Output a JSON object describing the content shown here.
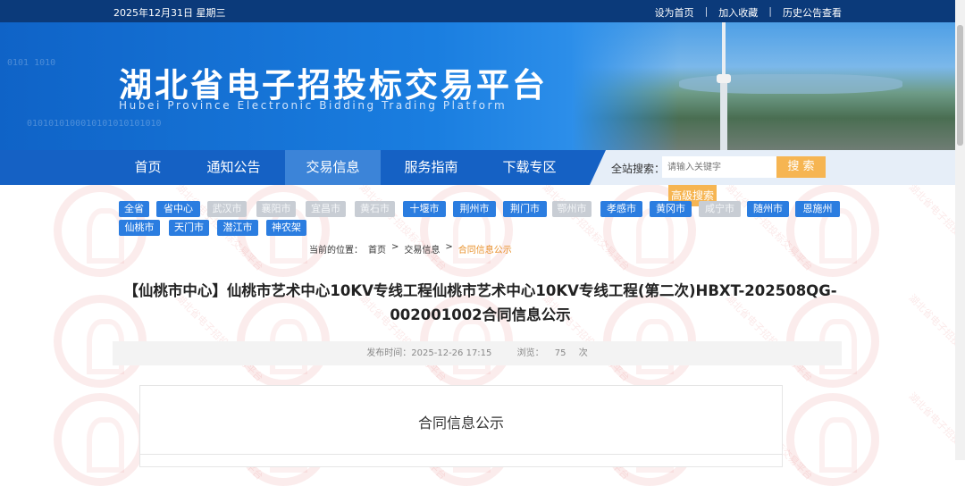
{
  "topbar": {
    "date": "2025年12月31日 星期三",
    "links": [
      "设为首页",
      "加入收藏",
      "历史公告查看"
    ],
    "separator": "|"
  },
  "banner": {
    "title": "湖北省电子招投标交易平台",
    "subtitle": "Hubei Province Electronic Bidding Trading Platform"
  },
  "nav": {
    "items": [
      "首页",
      "通知公告",
      "交易信息",
      "服务指南",
      "下载专区"
    ],
    "active_index": 2,
    "search_label": "全站搜索：",
    "search_placeholder": "请输入关键字",
    "search_button": "搜 索",
    "advanced_search": "高级搜索"
  },
  "cities": [
    {
      "label": "全省",
      "enabled": true
    },
    {
      "label": "省中心",
      "enabled": true
    },
    {
      "label": "武汉市",
      "enabled": false
    },
    {
      "label": "襄阳市",
      "enabled": false
    },
    {
      "label": "宜昌市",
      "enabled": false
    },
    {
      "label": "黄石市",
      "enabled": false
    },
    {
      "label": "十堰市",
      "enabled": true
    },
    {
      "label": "荆州市",
      "enabled": true
    },
    {
      "label": "荆门市",
      "enabled": true
    },
    {
      "label": "鄂州市",
      "enabled": false
    },
    {
      "label": "孝感市",
      "enabled": true
    },
    {
      "label": "黄冈市",
      "enabled": true
    },
    {
      "label": "咸宁市",
      "enabled": false
    },
    {
      "label": "随州市",
      "enabled": true
    },
    {
      "label": "恩施州",
      "enabled": true
    },
    {
      "label": "仙桃市",
      "enabled": true
    },
    {
      "label": "天门市",
      "enabled": true
    },
    {
      "label": "潜江市",
      "enabled": true
    },
    {
      "label": "神农架",
      "enabled": true
    }
  ],
  "breadcrumb": {
    "label": "当前的位置：",
    "items": [
      "首页",
      "交易信息",
      "合同信息公示"
    ],
    "separator": ">"
  },
  "article": {
    "title_line1": "【仙桃市中心】仙桃市艺术中心10KV专线工程仙桃市艺术中心10KV专线工程(第二次)HBXT-202508QG-",
    "title_line2": "002001002合同信息公示",
    "publish_label": "发布时间：",
    "publish_time": "2025-12-26 17:15",
    "views_label": "浏览：",
    "views": "75",
    "views_unit": "次",
    "section_title": "合同信息公示"
  },
  "watermark_text": "湖北省电子招投标交易平台",
  "colors": {
    "topbar": "#0b3a7a",
    "nav": "#1561c4",
    "accent": "#f6b552",
    "city_active": "#2b7de0",
    "city_disabled": "#c8cdd4",
    "crumb_current": "#e8912b"
  }
}
